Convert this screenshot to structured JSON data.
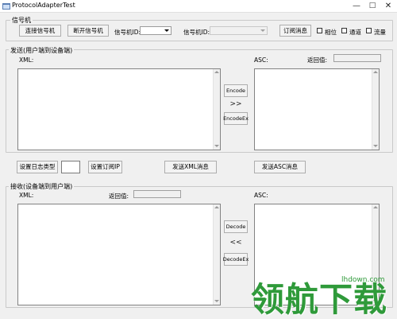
{
  "window": {
    "title": "ProtocolAdapterTest",
    "minimize": "—",
    "maximize": "□",
    "close": "✕"
  },
  "signal_group": {
    "label": "信号机",
    "connect_button": "连接信号机",
    "disconnect_button": "断开信号机",
    "signal_id_label": "信号机ID:",
    "signal_id_value": "",
    "signal_id2_label": "信号机ID:",
    "signal_id2_value": "",
    "subscribe_button": "订阅消息",
    "phase_checkbox": "相位",
    "channel_checkbox": "通道",
    "flow_checkbox": "流量"
  },
  "send_group": {
    "label": "发送(用户端到设备端)",
    "xml_label": "XML:",
    "asc_label": "ASC:",
    "return_label": "返回值:",
    "return_value": "",
    "xml_text": "",
    "asc_text": "",
    "encode_button": "Encode",
    "encode_arrow": ">>",
    "encodeex_button": "EncodeEx"
  },
  "middle_row": {
    "set_log_type_button": "设置日志类型",
    "log_type_value": "",
    "set_subscribe_ip_button": "设置订阅IP",
    "send_xml_button": "发送XML消息",
    "send_asc_button": "发送ASC消息"
  },
  "receive_group": {
    "label": "接收(设备端到用户端)",
    "xml_label": "XML:",
    "return_label": "返回值:",
    "return_value": "",
    "asc_label": "ASC:",
    "xml_text": "",
    "asc_text": "",
    "decode_button": "Decode",
    "decode_arrow": "<<",
    "decodeex_button": "DecodeEx"
  },
  "watermark": {
    "text": "领航下载",
    "site": "lhdown.com"
  },
  "colors": {
    "window_bg": "#f0f0f0",
    "watermark_green": "#2f9a3a"
  }
}
